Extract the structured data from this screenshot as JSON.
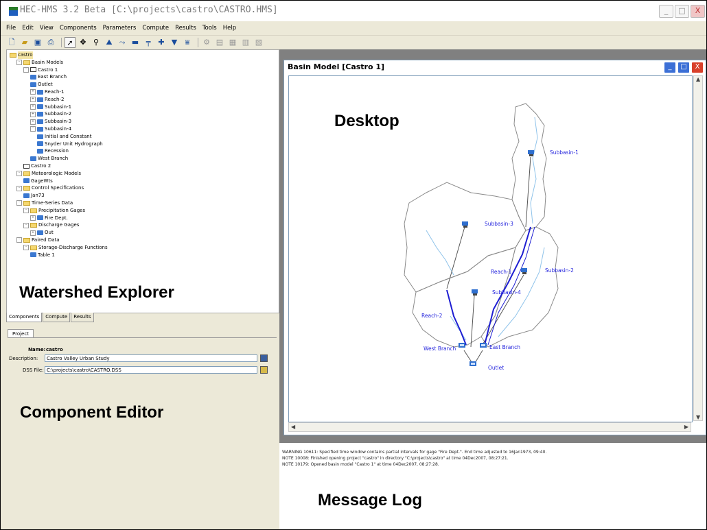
{
  "app": {
    "title": "HEC-HMS 3.2 Beta [C:\\projects\\castro\\CASTRO.HMS]",
    "min_glyph": "_",
    "max_glyph": "□",
    "close_glyph": "X"
  },
  "menu": [
    "File",
    "Edit",
    "View",
    "Components",
    "Parameters",
    "Compute",
    "Results",
    "Tools",
    "Help"
  ],
  "toolbar_icons": [
    "new-file-icon",
    "open-folder-icon",
    "save-icon",
    "print-icon",
    "arrow-tool-icon",
    "move-tool-icon",
    "zoom-tool-icon",
    "subbasin-tool-icon",
    "reach-tool-icon",
    "reservoir-tool-icon",
    "junction-tool-icon",
    "diversion-tool-icon",
    "source-tool-icon",
    "sink-tool-icon",
    "compute-icon",
    "results-graph-icon",
    "results-summary-icon",
    "results-table-icon",
    "results-ts-icon"
  ],
  "explorer": {
    "tree": [
      {
        "label": "castro",
        "indent": 0,
        "icon": "folder",
        "selected": true
      },
      {
        "label": "Basin Models",
        "indent": 1,
        "icon": "folder",
        "pm": "-"
      },
      {
        "label": "Castro 1",
        "indent": 2,
        "icon": "basin",
        "pm": "-"
      },
      {
        "label": "East Branch",
        "indent": 3,
        "icon": "junction"
      },
      {
        "label": "Outlet",
        "indent": 3,
        "icon": "junction"
      },
      {
        "label": "Reach-1",
        "indent": 3,
        "icon": "reach",
        "pm": "+"
      },
      {
        "label": "Reach-2",
        "indent": 3,
        "icon": "reach",
        "pm": "+"
      },
      {
        "label": "Subbasin-1",
        "indent": 3,
        "icon": "subbasin",
        "pm": "+"
      },
      {
        "label": "Subbasin-2",
        "indent": 3,
        "icon": "subbasin",
        "pm": "+"
      },
      {
        "label": "Subbasin-3",
        "indent": 3,
        "icon": "subbasin",
        "pm": "+"
      },
      {
        "label": "Subbasin-4",
        "indent": 3,
        "icon": "subbasin",
        "pm": "-"
      },
      {
        "label": "Initial and Constant",
        "indent": 4,
        "icon": "method"
      },
      {
        "label": "Snyder Unit Hydrograph",
        "indent": 4,
        "icon": "method"
      },
      {
        "label": "Recession",
        "indent": 4,
        "icon": "method"
      },
      {
        "label": "West Branch",
        "indent": 3,
        "icon": "junction"
      },
      {
        "label": "Castro 2",
        "indent": 2,
        "icon": "basin"
      },
      {
        "label": "Meteorologic Models",
        "indent": 1,
        "icon": "folder",
        "pm": "-"
      },
      {
        "label": "GageWts",
        "indent": 2,
        "icon": "met"
      },
      {
        "label": "Control Specifications",
        "indent": 1,
        "icon": "folder",
        "pm": "-"
      },
      {
        "label": "Jan73",
        "indent": 2,
        "icon": "control"
      },
      {
        "label": "Time-Series Data",
        "indent": 1,
        "icon": "folder",
        "pm": "-"
      },
      {
        "label": "Precipitation Gages",
        "indent": 2,
        "icon": "folder",
        "pm": "-"
      },
      {
        "label": "Fire Dept.",
        "indent": 3,
        "icon": "gage",
        "pm": "+"
      },
      {
        "label": "Discharge Gages",
        "indent": 2,
        "icon": "folder",
        "pm": "-"
      },
      {
        "label": "Out",
        "indent": 3,
        "icon": "gage",
        "pm": "+"
      },
      {
        "label": "Paired Data",
        "indent": 1,
        "icon": "folder",
        "pm": "-"
      },
      {
        "label": "Storage-Discharge Functions",
        "indent": 2,
        "icon": "folder",
        "pm": "-"
      },
      {
        "label": "Table 1",
        "indent": 3,
        "icon": "table"
      }
    ],
    "tabs": [
      "Components",
      "Compute",
      "Results"
    ],
    "overlay_label": "Watershed Explorer"
  },
  "editor": {
    "tab": "Project",
    "name_label": "Name:",
    "name_value": "castro",
    "description_label": "Description:",
    "description_value": "Castro Valley Urban Study",
    "dss_label": "DSS File:",
    "dss_value": "C:\\projects\\castro\\CASTRO.DSS",
    "overlay_label": "Component Editor"
  },
  "desktop": {
    "overlay_label": "Desktop",
    "basin_window_title": "Basin Model [Castro 1]",
    "elements": [
      {
        "name": "Subbasin-1",
        "kind": "subbasin"
      },
      {
        "name": "Subbasin-2",
        "kind": "subbasin"
      },
      {
        "name": "Subbasin-3",
        "kind": "subbasin"
      },
      {
        "name": "Subbasin-4",
        "kind": "subbasin"
      },
      {
        "name": "Reach-1",
        "kind": "reach"
      },
      {
        "name": "Reach-2",
        "kind": "reach"
      },
      {
        "name": "West Branch",
        "kind": "junction"
      },
      {
        "name": "East Branch",
        "kind": "junction"
      },
      {
        "name": "Outlet",
        "kind": "junction"
      }
    ]
  },
  "log": {
    "overlay_label": "Message Log",
    "lines": [
      "WARNING 10611:  Specified time window contains partial intervals for gage \"Fire Dept.\".  End time adjusted to 16Jan1973, 09:40.",
      "NOTE 10008:  Finished opening project \"castro\" in directory \"C:\\projects\\castro\" at time 04Dec2007, 08:27:21.",
      "NOTE 10179:  Opened basin model \"Castro 1\" at time 04Dec2007, 08:27:28."
    ]
  },
  "colors": {
    "label_blue": "#1f1fdc",
    "reach_blue": "#1e1ed2",
    "stream_blue": "#8fc3ea",
    "boundary_gray": "#8a8a8a",
    "desktop_gray": "#808080"
  }
}
